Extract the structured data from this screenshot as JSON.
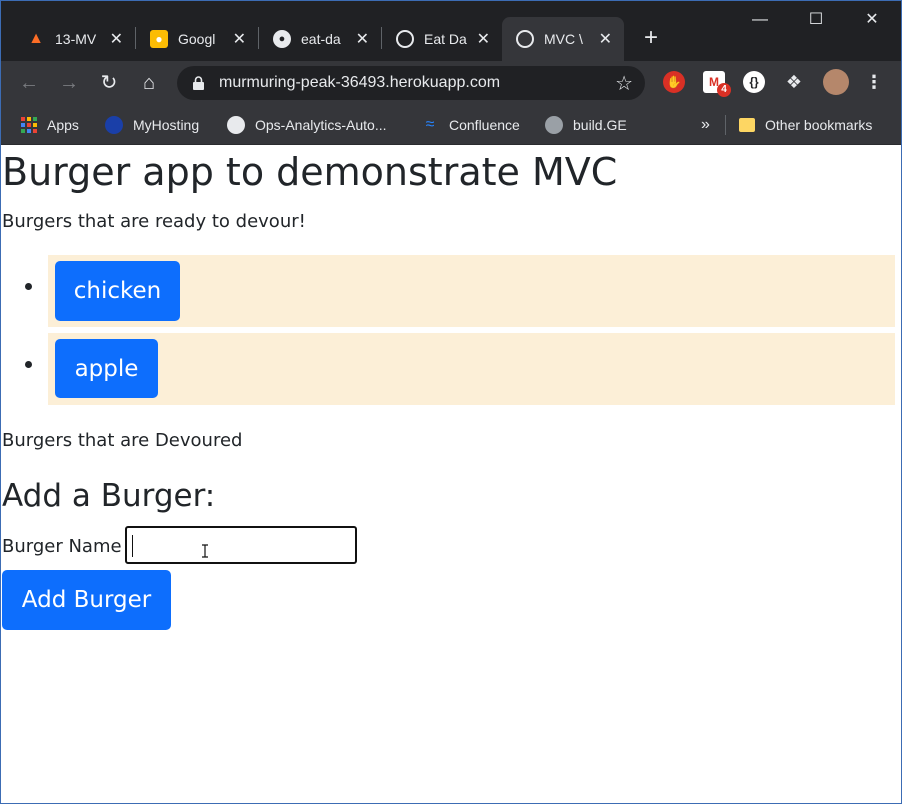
{
  "browser": {
    "tabs": [
      {
        "title": "13-MV",
        "icon": "gitlab-icon"
      },
      {
        "title": "Googl",
        "icon": "google-keep-icon"
      },
      {
        "title": "eat-da",
        "icon": "github-icon"
      },
      {
        "title": "Eat Da",
        "icon": "globe-icon"
      },
      {
        "title": "MVC \\",
        "icon": "globe-icon",
        "active": true
      }
    ],
    "new_tab": "+",
    "url": "murmuring-peak-36493.herokuapp.com",
    "notification_count": "4",
    "bookmarks": [
      {
        "label": "Apps",
        "icon": "apps-grid-icon"
      },
      {
        "label": "MyHosting",
        "icon": "myhosting-icon"
      },
      {
        "label": "Ops-Analytics-Auto...",
        "icon": "github-icon"
      },
      {
        "label": "Confluence",
        "icon": "confluence-icon"
      },
      {
        "label": "build.GE",
        "icon": "ge-icon"
      }
    ],
    "overflow": "»",
    "other_bookmarks": "Other bookmarks"
  },
  "page": {
    "title": "Burger app to demonstrate MVC",
    "ready_heading": "Burgers that are ready to devour!",
    "ready_burgers": [
      "chicken",
      "apple"
    ],
    "devoured_heading": "Burgers that are Devoured",
    "devoured_burgers": [],
    "form_heading": "Add a Burger:",
    "name_label": "Burger Name",
    "name_value": "",
    "submit_label": "Add Burger"
  },
  "colors": {
    "primary_button": "#0d6efd",
    "list_item_bg": "#fcefd7",
    "chrome_dark": "#202124",
    "chrome_toolbar": "#35363a"
  }
}
